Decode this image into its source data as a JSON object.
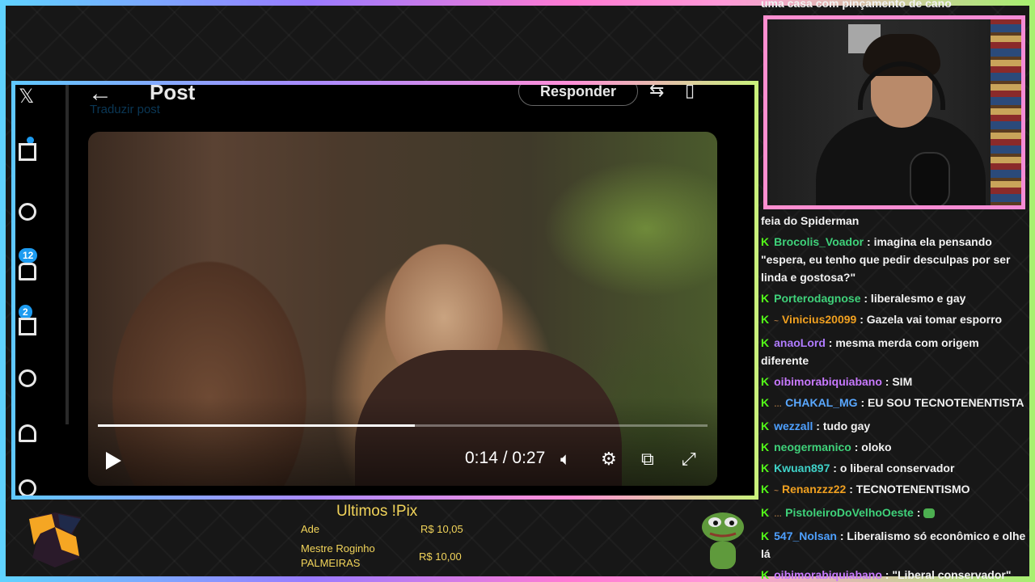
{
  "video_post": {
    "header_title": "Post",
    "translate_link": "Traduzir post",
    "reply_button": "Responder",
    "badges": [
      "12",
      "2"
    ],
    "player": {
      "current_time": "0:14",
      "duration": "0:27",
      "time_sep": "/",
      "progress_fraction": 0.52
    }
  },
  "chat": {
    "top_fragment": "uma casa com pinçamento de cano",
    "messages": [
      {
        "user": "",
        "user_color": "#f2f2f2",
        "text": "feia do Spiderman",
        "has_k": false,
        "prefix": ""
      },
      {
        "user": "Brocolis_Voador",
        "user_color": "#3fd27a",
        "text": ": imagina ela pensando \"espera, eu tenho que pedir desculpas por ser linda e gostosa?\"",
        "has_k": true,
        "prefix": ""
      },
      {
        "user": "Porterodagnose",
        "user_color": "#3fd27a",
        "text": ": liberalesmo e gay",
        "has_k": true,
        "prefix": ""
      },
      {
        "user": "Vinicius20099",
        "user_color": "#f0a020",
        "text": ": Gazela vai tomar esporro",
        "has_k": true,
        "prefix": "~"
      },
      {
        "user": "anaoLord",
        "user_color": "#b07bff",
        "text": ": mesma merda com origem diferente",
        "has_k": true,
        "prefix": ""
      },
      {
        "user": "oibimorabiquiabano",
        "user_color": "#c879ff",
        "text": ": SIM",
        "has_k": true,
        "prefix": ""
      },
      {
        "user": "CHAKAL_MG",
        "user_color": "#5aa8ff",
        "text": ": EU SOU TECNOTENENTISTA",
        "has_k": true,
        "prefix": "…"
      },
      {
        "user": "wezzall",
        "user_color": "#4ea0ff",
        "text": ": tudo gay",
        "has_k": true,
        "prefix": ""
      },
      {
        "user": "neogermanico",
        "user_color": "#3fd27a",
        "text": ": oloko",
        "has_k": true,
        "prefix": ""
      },
      {
        "user": "Kwuan897",
        "user_color": "#3fd2c8",
        "text": ": o liberal conservador",
        "has_k": true,
        "prefix": ""
      },
      {
        "user": "Renanzzz22",
        "user_color": "#f0a020",
        "text": ": TECNOTENENTISMO",
        "has_k": true,
        "prefix": "~"
      },
      {
        "user": "PistoleiroDoVelhoOeste",
        "user_color": "#3fd27a",
        "text": ":",
        "has_k": true,
        "prefix": "…",
        "emote": true
      },
      {
        "user": "547_Nolsan",
        "user_color": "#4ea0ff",
        "text": ": Liberalismo só econômico e olhe lá",
        "has_k": true,
        "prefix": ""
      },
      {
        "user": "oibimorabiquiabano",
        "user_color": "#c879ff",
        "text": ": \"Liberal conservador\"",
        "has_k": true,
        "prefix": ""
      }
    ]
  },
  "pix": {
    "title": "Ultimos !Pix",
    "entries": [
      {
        "name": "Ade",
        "amount": "R$ 10,05"
      },
      {
        "name": "Mestre Roginho PALMEIRAS",
        "amount": "R$ 10,00"
      }
    ]
  },
  "icons": [
    "x-logo-icon",
    "home-icon",
    "search-icon",
    "notifications-icon",
    "messages-icon",
    "grok-icon",
    "profile-icon",
    "more-icon",
    "back-arrow-icon",
    "play-icon",
    "volume-icon",
    "settings-icon",
    "pip-icon",
    "fullscreen-icon"
  ],
  "colors": {
    "accent_blue": "#1d9bf0",
    "kick_green": "#53fc18",
    "pix_yellow": "#f2d45a"
  }
}
